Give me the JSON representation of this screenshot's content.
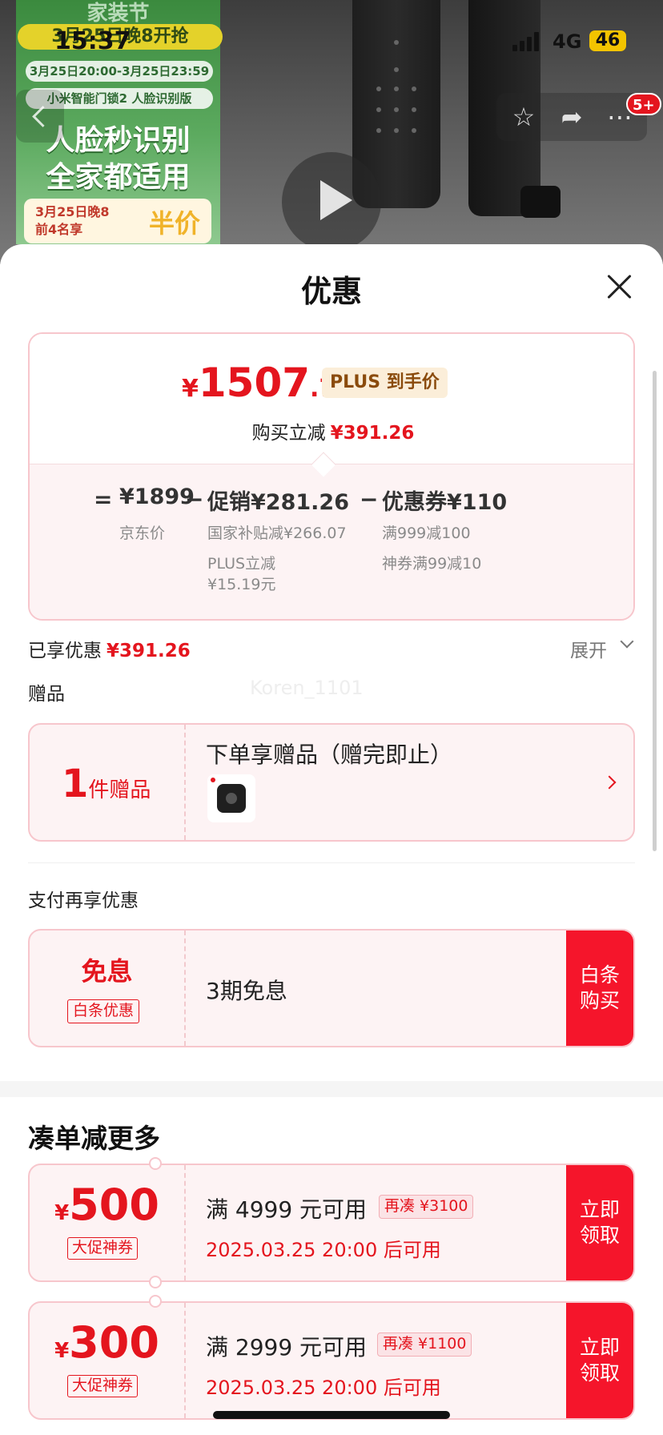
{
  "status_bar": {
    "time": "15:37",
    "network": "4G",
    "battery": "46"
  },
  "nav": {
    "badge": "5+"
  },
  "promo": {
    "head": "家装节",
    "start_pill": "3月25日晚8开抢",
    "date_range": "3月25日20:00-3月25日23:59",
    "product_name": "小米智能门锁2 人脸识别版",
    "line1": "人脸秒识别",
    "line2": "全家都适用",
    "bottom_line1": "3月25日晚8",
    "bottom_line2": "前4名享",
    "bottom_half": "半价"
  },
  "sheet": {
    "title": "优惠",
    "price_card": {
      "currency": "¥",
      "price_int": "1507",
      "price_dec": ".74",
      "plus_tag": "PLUS 到手价",
      "buy_reduce_label": "购买立减",
      "buy_reduce_value": "¥391.26",
      "eq": "=",
      "jd_price": "¥1899",
      "jd_price_label": "京东价",
      "minus1": "−",
      "promo_value": "促销¥281.26",
      "promo_detail1": "国家补贴减¥266.07",
      "promo_detail2a": "PLUS立减",
      "promo_detail2b": "¥15.19元",
      "minus2": "−",
      "coupon_value": "优惠券¥110",
      "coupon_detail1": "满999减100",
      "coupon_detail2": "神券满99减10"
    },
    "enjoyed_label": "已享优惠",
    "enjoyed_value": "¥391.26",
    "expand_label": "展开",
    "gift_section_label": "赠品",
    "watermark": "Koren_1101",
    "gift": {
      "count": "1",
      "count_unit": "件赠品",
      "title": "下单享赠品（赠完即止）"
    },
    "pay_section_label": "支付再享优惠",
    "pay": {
      "big": "免息",
      "tag": "白条优惠",
      "text": "3期免息",
      "button_line1": "白条",
      "button_line2": "购买"
    },
    "more_title": "凑单减更多",
    "coupons": [
      {
        "currency": "¥",
        "amount": "500",
        "tag": "大促神券",
        "condition": "满 4999 元可用",
        "extra": "再凑 ¥3100",
        "time": "2025.03.25 20:00 后可用",
        "button_line1": "立即",
        "button_line2": "领取"
      },
      {
        "currency": "¥",
        "amount": "300",
        "tag": "大促神券",
        "condition": "满 2999 元可用",
        "extra": "再凑 ¥1100",
        "time": "2025.03.25 20:00 后可用",
        "button_line1": "立即",
        "button_line2": "领取"
      }
    ]
  },
  "colors": {
    "accent_red": "#e4151e",
    "button_red": "#f5152b",
    "card_pink_bg": "#fdf3f4",
    "card_border": "#f7c6cc",
    "plus_gold": "#8a4b0c"
  }
}
